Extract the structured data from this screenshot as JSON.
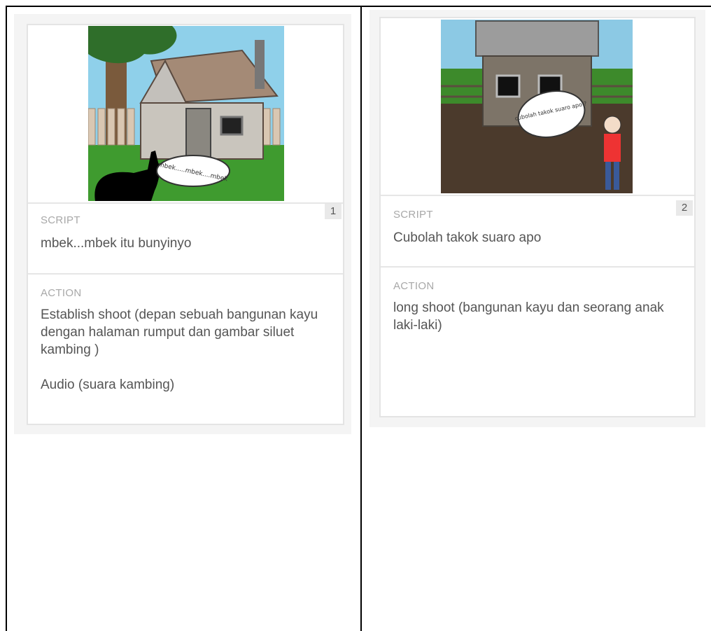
{
  "cells": [
    {
      "number": "1",
      "script_label": "SCRIPT",
      "script_text": "mbek...mbek itu bunyinyo",
      "action_label": "ACTION",
      "action_text": "Establish shoot  (depan sebuah bangunan kayu dengan halaman rumput dan gambar siluet kambing )\n\nAudio (suara kambing)",
      "bubble_text": "mbek.....mbek....mbek"
    },
    {
      "number": "2",
      "script_label": "SCRIPT",
      "script_text": "Cubolah takok suaro apo",
      "action_label": "ACTION",
      "action_text": "long shoot (bangunan kayu dan seorang anak laki-laki)",
      "bubble_text": "cubolah takok suaro apo ?"
    }
  ]
}
